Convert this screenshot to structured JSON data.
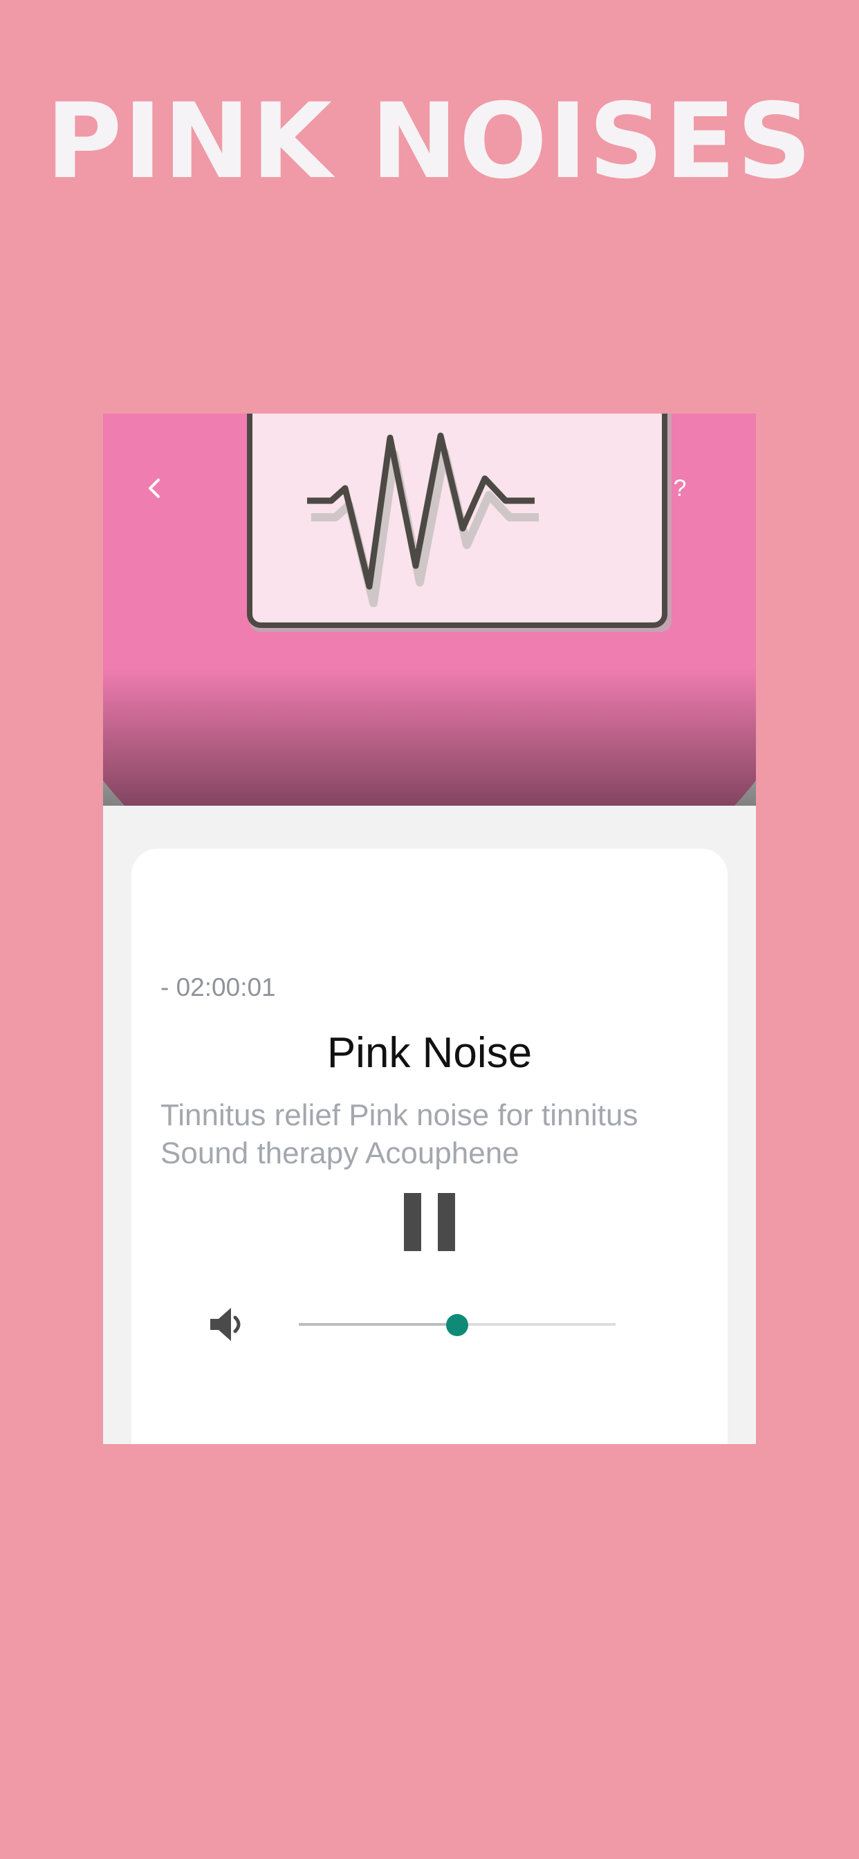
{
  "headline": "PINK NOISES",
  "nav": {
    "back_icon": "chevron-left-icon",
    "help_label": "?"
  },
  "player": {
    "remaining_time": "- 02:00:01",
    "title": "Pink Noise",
    "subtitle": "Tinnitus relief Pink noise for tinnitus Sound therapy Acouphene",
    "control_icon": "pause-icon",
    "volume_icon": "speaker-icon",
    "volume_level": 0.5
  },
  "colors": {
    "background": "#ef9aa6",
    "accent": "#0f8a77",
    "hero_pink": "#ef7db0"
  }
}
